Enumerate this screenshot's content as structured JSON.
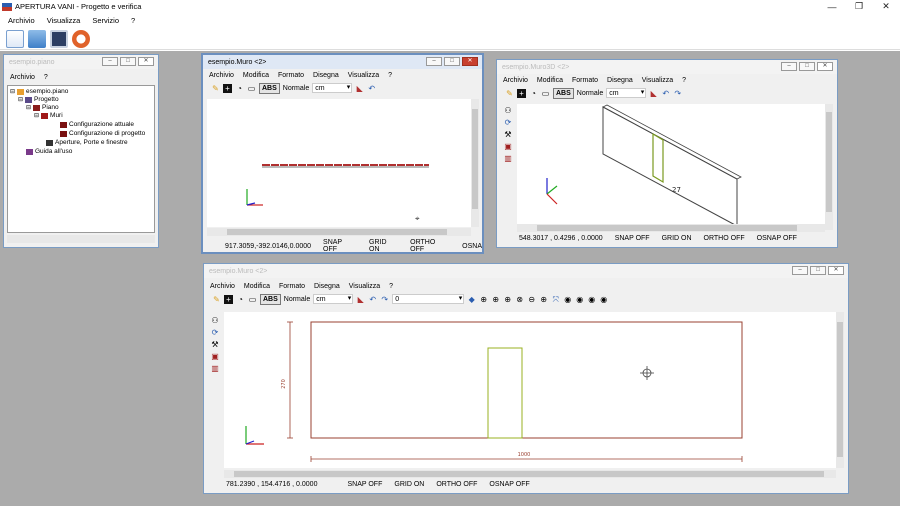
{
  "app": {
    "title": "APERTURA VANI - Progetto e verifica",
    "minimize": "—",
    "maximize": "❐",
    "close": "✕"
  },
  "menu": [
    "Archivio",
    "Visualizza",
    "Servizio",
    "?"
  ],
  "toolbar_icons": [
    "new-file-icon",
    "open-folder-icon",
    "save-icon",
    "help-lifebuoy-icon"
  ],
  "project_window": {
    "title": "esempio.piano",
    "menu": [
      "Archivio",
      "?"
    ],
    "tree": [
      {
        "label": "esempio.piano",
        "icon": "house-icon"
      },
      {
        "label": "Progetto",
        "icon": "people-icon"
      },
      {
        "label": "Piano",
        "icon": "plan-icon"
      },
      {
        "label": "Muri",
        "icon": "wall-icon"
      },
      {
        "label": "Configurazione attuale",
        "icon": "config-icon"
      },
      {
        "label": "Configurazione di progetto",
        "icon": "config-icon"
      },
      {
        "label": "Aperture, Porte e finestre",
        "icon": "opening-icon"
      },
      {
        "label": "Guida all'uso",
        "icon": "guide-icon"
      }
    ]
  },
  "wall_window": {
    "title": "esempio.Muro <2>",
    "menu": [
      "Archivio",
      "Modifica",
      "Formato",
      "Disegna",
      "Visualizza",
      "?"
    ],
    "abs": "ABS",
    "line_style": "Normale",
    "unit": "cm",
    "coords": "917.3059,-392.0146,0.0000",
    "status": [
      "SNAP OFF",
      "GRID ON",
      "ORTHO OFF",
      "OSNA"
    ]
  },
  "wall3d_window": {
    "title": "esempio.Muro3D <2>",
    "menu": [
      "Archivio",
      "Modifica",
      "Formato",
      "Disegna",
      "Visualizza",
      "?"
    ],
    "abs": "ABS",
    "line_style": "Normale",
    "unit": "cm",
    "label_3d": "27",
    "coords": "548.3017 , 0.4296 , 0.0000",
    "status": [
      "SNAP OFF",
      "GRID ON",
      "ORTHO OFF",
      "OSNAP OFF"
    ]
  },
  "elevation_window": {
    "title": "esempio.Muro <2>",
    "menu": [
      "Archivio",
      "Modifica",
      "Formato",
      "Disegna",
      "Visualizza",
      "?"
    ],
    "abs": "ABS",
    "line_style": "Normale",
    "unit": "cm",
    "layer": "0",
    "height_label": "270",
    "width_label": "1000",
    "coords": "781.2390 , 154.4716 , 0.0000",
    "status": [
      "SNAP OFF",
      "GRID ON",
      "ORTHO OFF",
      "OSNAP OFF"
    ]
  }
}
